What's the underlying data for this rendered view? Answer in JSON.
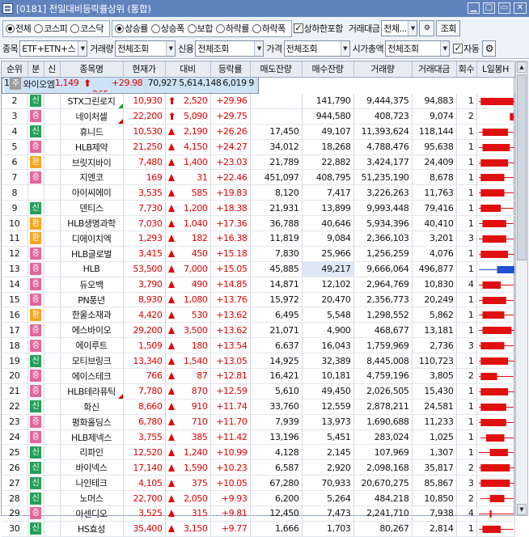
{
  "window": {
    "title": "[0181] 전일대비등락률상위 (통합)"
  },
  "market_options": [
    {
      "label": "전체",
      "on": true
    },
    {
      "label": "코스피",
      "on": false
    },
    {
      "label": "코스닥",
      "on": false
    }
  ],
  "change_options": [
    {
      "label": "상승률",
      "on": true
    },
    {
      "label": "상승폭",
      "on": false
    },
    {
      "label": "보합",
      "on": false
    },
    {
      "label": "하락률",
      "on": false
    },
    {
      "label": "하락폭",
      "on": false
    }
  ],
  "limit_include": {
    "label": "상하한포함",
    "checked": true
  },
  "trade_amount": {
    "label": "거래대금",
    "value": "전체..."
  },
  "lookup_button": "조회",
  "filters": {
    "stock_label": "종목",
    "stock_value": "ETF+ETN+스",
    "volume_label": "거래량",
    "volume_value": "전체조회",
    "credit_label": "신용",
    "credit_value": "전체조회",
    "price_label": "가격",
    "price_value": "전체조회",
    "mcap_label": "시가총액",
    "mcap_value": "전체조회",
    "auto_label": "자동",
    "auto_checked": true
  },
  "columns": [
    "순위",
    "분",
    "신",
    "종목명",
    "현재가",
    "대비",
    "등락률",
    "매도잔량",
    "매수잔량",
    "거래량",
    "거래대금",
    "회수",
    "L일봉H"
  ],
  "colors": {
    "up": "#e00000",
    "kosdaq_badge": "#e0679b",
    "kospi_badge": "#22a05a",
    "warn_badge": "#f5a623",
    "gray_badge": "#9e9e9e",
    "bar_red": "#e01010",
    "bar_blue": "#1e52d0"
  },
  "rows": [
    {
      "rank": "1",
      "bun": "주",
      "bun_color": "#9e9e9e",
      "name": "와이오엠",
      "price": "1,149",
      "diff": "265",
      "diff_type": "limit",
      "rate": "+29.98",
      "sell": "",
      "buy": "70,927",
      "vol": "5,614,148",
      "amt": "6,019",
      "cnt": "9",
      "corner": "",
      "bar": {
        "o": 0.05,
        "c": 0.95,
        "l": 0.0,
        "h": 1.0,
        "color": "red"
      }
    },
    {
      "rank": "2",
      "bun": "신",
      "bun_color": "#22a05a",
      "name": "STX그린로지",
      "price": "10,930",
      "diff": "2,520",
      "diff_type": "limit",
      "rate": "+29.96",
      "sell": "",
      "buy": "141,790",
      "vol": "9,444,375",
      "amt": "94,883",
      "cnt": "1",
      "corner": "g",
      "bar": {
        "o": 0.05,
        "c": 0.95,
        "l": 0.0,
        "h": 1.0,
        "color": "red"
      }
    },
    {
      "rank": "3",
      "bun": "증",
      "bun_color": "#e0679b",
      "name": "네이처셀",
      "price": "22,200",
      "diff": "5,090",
      "diff_type": "limit",
      "rate": "+29.75",
      "sell": "",
      "buy": "944,580",
      "vol": "408,723",
      "amt": "9,074",
      "cnt": "2",
      "corner": "r",
      "bar": {
        "o": 0.85,
        "c": 0.95,
        "l": 0.85,
        "h": 1.0,
        "color": "red"
      }
    },
    {
      "rank": "4",
      "bun": "신",
      "bun_color": "#22a05a",
      "name": "휴니드",
      "price": "10,530",
      "diff": "2,190",
      "diff_type": "up",
      "rate": "+26.26",
      "sell": "17,450",
      "buy": "49,107",
      "vol": "11,393,624",
      "amt": "118,144",
      "cnt": "1",
      "corner": "",
      "bar": {
        "o": 0.1,
        "c": 0.8,
        "l": 0.0,
        "h": 0.95,
        "color": "red"
      }
    },
    {
      "rank": "5",
      "bun": "증",
      "bun_color": "#e0679b",
      "name": "HLB제약",
      "price": "21,250",
      "diff": "4,150",
      "diff_type": "up",
      "rate": "+24.27",
      "sell": "34,012",
      "buy": "18,268",
      "vol": "4,788,476",
      "amt": "95,638",
      "cnt": "1",
      "corner": "",
      "bar": {
        "o": 0.1,
        "c": 0.85,
        "l": 0.0,
        "h": 1.0,
        "color": "red"
      }
    },
    {
      "rank": "6",
      "bun": "환",
      "bun_color": "#f5a623",
      "name": "브릿지바이",
      "price": "7,480",
      "diff": "1,400",
      "diff_type": "up",
      "rate": "+23.03",
      "sell": "21,789",
      "buy": "22,882",
      "vol": "3,424,177",
      "amt": "24,409",
      "cnt": "1",
      "corner": "",
      "bar": {
        "o": 0.05,
        "c": 0.8,
        "l": 0.0,
        "h": 1.0,
        "color": "red"
      }
    },
    {
      "rank": "7",
      "bun": "증",
      "bun_color": "#e0679b",
      "name": "지엔코",
      "price": "169",
      "diff": "31",
      "diff_type": "up",
      "rate": "+22.46",
      "sell": "451,097",
      "buy": "408,795",
      "vol": "51,235,190",
      "amt": "8,678",
      "cnt": "1",
      "corner": "",
      "bar": {
        "o": 0.05,
        "c": 0.7,
        "l": 0.0,
        "h": 0.95,
        "color": "red"
      }
    },
    {
      "rank": "8",
      "bun": "",
      "bun_color": "",
      "name": "아이씨에이",
      "price": "3,535",
      "diff": "585",
      "diff_type": "up",
      "rate": "+19.83",
      "sell": "8,120",
      "buy": "7,417",
      "vol": "3,226,263",
      "amt": "11,763",
      "cnt": "1",
      "corner": "",
      "bar": {
        "o": 0.05,
        "c": 0.7,
        "l": 0.0,
        "h": 0.95,
        "color": "red"
      }
    },
    {
      "rank": "9",
      "bun": "신",
      "bun_color": "#22a05a",
      "name": "덴티스",
      "price": "7,730",
      "diff": "1,200",
      "diff_type": "up",
      "rate": "+18.38",
      "sell": "21,931",
      "buy": "13,899",
      "vol": "9,993,448",
      "amt": "79,416",
      "cnt": "1",
      "corner": "",
      "bar": {
        "o": 0.05,
        "c": 0.6,
        "l": 0.0,
        "h": 0.95,
        "color": "red"
      }
    },
    {
      "rank": "10",
      "bun": "환",
      "bun_color": "#f5a623",
      "name": "HLB생명과학",
      "price": "7,030",
      "diff": "1,040",
      "diff_type": "up",
      "rate": "+17.36",
      "sell": "36,788",
      "buy": "40,646",
      "vol": "5,934,396",
      "amt": "40,410",
      "cnt": "1",
      "corner": "",
      "bar": {
        "o": 0.1,
        "c": 0.75,
        "l": 0.0,
        "h": 0.95,
        "color": "red"
      }
    },
    {
      "rank": "11",
      "bun": "환",
      "bun_color": "#f5a623",
      "name": "디에이치엑",
      "price": "1,293",
      "diff": "182",
      "diff_type": "up",
      "rate": "+16.38",
      "sell": "11,819",
      "buy": "9,084",
      "vol": "2,366,103",
      "amt": "3,201",
      "cnt": "3",
      "corner": "",
      "bar": {
        "o": 0.1,
        "c": 0.75,
        "l": 0.0,
        "h": 0.95,
        "color": "red"
      }
    },
    {
      "rank": "12",
      "bun": "증",
      "bun_color": "#e0679b",
      "name": "HLB글로벌",
      "price": "3,415",
      "diff": "450",
      "diff_type": "up",
      "rate": "+15.18",
      "sell": "7,830",
      "buy": "25,966",
      "vol": "1,256,259",
      "amt": "4,076",
      "cnt": "1",
      "corner": "",
      "bar": {
        "o": 0.05,
        "c": 0.8,
        "l": 0.0,
        "h": 1.0,
        "color": "red"
      }
    },
    {
      "rank": "13",
      "bun": "증",
      "bun_color": "#e0679b",
      "name": "HLB",
      "price": "53,500",
      "diff": "7,000",
      "diff_type": "up",
      "rate": "+15.05",
      "sell": "45,885",
      "buy": "49,217",
      "vol": "9,666,064",
      "amt": "496,877",
      "cnt": "1",
      "corner": "",
      "bar": {
        "o": 0.5,
        "c": 0.98,
        "l": 0.0,
        "h": 0.98,
        "color": "blue"
      }
    },
    {
      "rank": "14",
      "bun": "증",
      "bun_color": "#e0679b",
      "name": "듀오백",
      "price": "3,790",
      "diff": "490",
      "diff_type": "up",
      "rate": "+14.85",
      "sell": "14,871",
      "buy": "12,102",
      "vol": "2,964,769",
      "amt": "10,830",
      "cnt": "4",
      "corner": "",
      "bar": {
        "o": 0.1,
        "c": 0.6,
        "l": 0.0,
        "h": 0.95,
        "color": "red"
      }
    },
    {
      "rank": "15",
      "bun": "증",
      "bun_color": "#e0679b",
      "name": "PN풍년",
      "price": "8,930",
      "diff": "1,080",
      "diff_type": "up",
      "rate": "+13.76",
      "sell": "15,972",
      "buy": "20,470",
      "vol": "2,356,773",
      "amt": "20,249",
      "cnt": "1",
      "corner": "",
      "bar": {
        "o": 0.1,
        "c": 0.75,
        "l": 0.0,
        "h": 0.95,
        "color": "red"
      }
    },
    {
      "rank": "16",
      "bun": "환",
      "bun_color": "#f5a623",
      "name": "한울소재과",
      "price": "4,420",
      "diff": "530",
      "diff_type": "up",
      "rate": "+13.62",
      "sell": "6,495",
      "buy": "5,548",
      "vol": "1,298,552",
      "amt": "5,862",
      "cnt": "1",
      "corner": "",
      "bar": {
        "o": 0.1,
        "c": 0.7,
        "l": 0.0,
        "h": 0.95,
        "color": "red"
      }
    },
    {
      "rank": "17",
      "bun": "증",
      "bun_color": "#e0679b",
      "name": "에스바이오",
      "price": "29,200",
      "diff": "3,500",
      "diff_type": "up",
      "rate": "+13.62",
      "sell": "21,071",
      "buy": "4,900",
      "vol": "468,677",
      "amt": "13,181",
      "cnt": "1",
      "corner": "",
      "bar": {
        "o": 0.1,
        "c": 0.9,
        "l": 0.0,
        "h": 1.0,
        "color": "red"
      }
    },
    {
      "rank": "18",
      "bun": "증",
      "bun_color": "#e0679b",
      "name": "에이루트",
      "price": "1,509",
      "diff": "180",
      "diff_type": "up",
      "rate": "+13.54",
      "sell": "6,637",
      "buy": "16,043",
      "vol": "1,759,969",
      "amt": "2,736",
      "cnt": "3",
      "corner": "",
      "bar": {
        "o": 0.05,
        "c": 0.7,
        "l": 0.0,
        "h": 0.95,
        "color": "red"
      }
    },
    {
      "rank": "19",
      "bun": "신",
      "bun_color": "#22a05a",
      "name": "모티브링크",
      "price": "13,340",
      "diff": "1,540",
      "diff_type": "up",
      "rate": "+13.05",
      "sell": "14,925",
      "buy": "32,389",
      "vol": "8,445,008",
      "amt": "110,723",
      "cnt": "1",
      "corner": "",
      "bar": {
        "o": 0.05,
        "c": 0.8,
        "l": 0.0,
        "h": 1.0,
        "color": "red"
      }
    },
    {
      "rank": "20",
      "bun": "증",
      "bun_color": "#e0679b",
      "name": "에이스테크",
      "price": "766",
      "diff": "87",
      "diff_type": "up",
      "rate": "+12.81",
      "sell": "16,421",
      "buy": "10,181",
      "vol": "4,759,196",
      "amt": "3,805",
      "cnt": "2",
      "corner": "",
      "bar": {
        "o": 0.05,
        "c": 0.5,
        "l": 0.0,
        "h": 0.95,
        "color": "red"
      }
    },
    {
      "rank": "21",
      "bun": "증",
      "bun_color": "#e0679b",
      "name": "HLB테라퓨틱",
      "price": "7,780",
      "diff": "870",
      "diff_type": "up",
      "rate": "+12.59",
      "sell": "5,610",
      "buy": "49,450",
      "vol": "2,026,505",
      "amt": "15,430",
      "cnt": "1",
      "corner": "r",
      "bar": {
        "o": 0.05,
        "c": 0.8,
        "l": 0.0,
        "h": 1.0,
        "color": "red"
      }
    },
    {
      "rank": "22",
      "bun": "신",
      "bun_color": "#22a05a",
      "name": "화신",
      "price": "8,660",
      "diff": "910",
      "diff_type": "up",
      "rate": "+11.74",
      "sell": "33,760",
      "buy": "12,559",
      "vol": "2,878,211",
      "amt": "24,581",
      "cnt": "1",
      "corner": "",
      "bar": {
        "o": 0.05,
        "c": 0.75,
        "l": 0.0,
        "h": 0.95,
        "color": "red"
      }
    },
    {
      "rank": "23",
      "bun": "증",
      "bun_color": "#e0679b",
      "name": "평화홀딩스",
      "price": "6,780",
      "diff": "710",
      "diff_type": "up",
      "rate": "+11.70",
      "sell": "7,939",
      "buy": "13,973",
      "vol": "1,690,688",
      "amt": "11,233",
      "cnt": "1",
      "corner": "",
      "bar": {
        "o": 0.05,
        "c": 0.75,
        "l": 0.0,
        "h": 0.95,
        "color": "red"
      }
    },
    {
      "rank": "24",
      "bun": "증",
      "bun_color": "#e0679b",
      "name": "HLB제넥스",
      "price": "3,755",
      "diff": "385",
      "diff_type": "up",
      "rate": "+11.42",
      "sell": "13,196",
      "buy": "5,451",
      "vol": "283,024",
      "amt": "1,025",
      "cnt": "1",
      "corner": "",
      "bar": {
        "o": 0.2,
        "c": 0.7,
        "l": 0.05,
        "h": 0.95,
        "color": "red"
      }
    },
    {
      "rank": "25",
      "bun": "신",
      "bun_color": "#22a05a",
      "name": "리파인",
      "price": "12,520",
      "diff": "1,240",
      "diff_type": "up",
      "rate": "+10.99",
      "sell": "4,128",
      "buy": "2,145",
      "vol": "107,969",
      "amt": "1,307",
      "cnt": "1",
      "corner": "",
      "bar": {
        "o": 0.3,
        "c": 0.8,
        "l": 0.0,
        "h": 0.95,
        "color": "red"
      }
    },
    {
      "rank": "26",
      "bun": "신",
      "bun_color": "#22a05a",
      "name": "바이넥스",
      "price": "17,140",
      "diff": "1,590",
      "diff_type": "up",
      "rate": "+10.23",
      "sell": "6,587",
      "buy": "2,920",
      "vol": "2,098,168",
      "amt": "35,817",
      "cnt": "2",
      "corner": "",
      "bar": {
        "o": 0.05,
        "c": 0.85,
        "l": 0.0,
        "h": 1.0,
        "color": "red"
      }
    },
    {
      "rank": "27",
      "bun": "신",
      "bun_color": "#22a05a",
      "name": "나인테크",
      "price": "4,105",
      "diff": "375",
      "diff_type": "up",
      "rate": "+10.05",
      "sell": "67,280",
      "buy": "70,933",
      "vol": "20,670,275",
      "amt": "85,867",
      "cnt": "3",
      "corner": "",
      "bar": {
        "o": 0.05,
        "c": 0.85,
        "l": 0.0,
        "h": 1.0,
        "color": "red"
      }
    },
    {
      "rank": "28",
      "bun": "신",
      "bun_color": "#22a05a",
      "name": "노머스",
      "price": "22,700",
      "diff": "2,050",
      "diff_type": "up",
      "rate": "+9.93",
      "sell": "6,200",
      "buy": "5,264",
      "vol": "484,218",
      "amt": "10,850",
      "cnt": "2",
      "corner": "",
      "bar": {
        "o": 0.3,
        "c": 0.7,
        "l": 0.05,
        "h": 0.95,
        "color": "red"
      }
    },
    {
      "rank": "29",
      "bun": "증",
      "bun_color": "#e0679b",
      "name": "아센디오",
      "price": "3,525",
      "diff": "315",
      "diff_type": "up",
      "rate": "+9.81",
      "sell": "12,450",
      "buy": "7,473",
      "vol": "2,241,710",
      "amt": "7,938",
      "cnt": "4",
      "corner": "",
      "bar": {
        "o": 0.3,
        "c": 0.35,
        "l": 0.0,
        "h": 0.95,
        "color": "red"
      }
    },
    {
      "rank": "30",
      "bun": "신",
      "bun_color": "#22a05a",
      "name": "HS효성",
      "price": "35,400",
      "diff": "3,150",
      "diff_type": "up",
      "rate": "+9.77",
      "sell": "1,666",
      "buy": "1,703",
      "vol": "80,267",
      "amt": "2,814",
      "cnt": "1",
      "corner": "",
      "bar": {
        "o": 0.1,
        "c": 0.6,
        "l": 0.0,
        "h": 0.95,
        "color": "red"
      }
    }
  ]
}
